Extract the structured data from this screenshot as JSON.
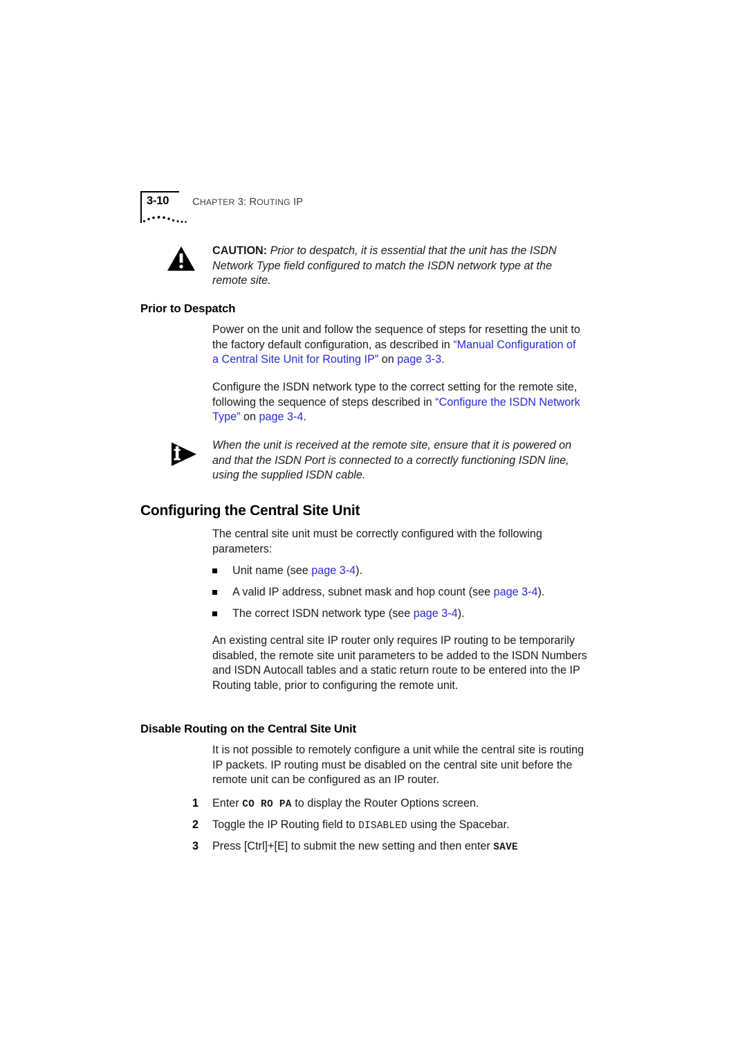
{
  "header": {
    "folio": "3-10",
    "chapter_prefix": "C",
    "chapter_rest": "HAPTER",
    "chapter_text": "CHAPTER 3: ROUTING IP",
    "chapter_number": "3:",
    "chapter_title_prefix": "R",
    "chapter_title_rest": "OUTING",
    "chapter_title_last": "IP"
  },
  "caution": {
    "icon": "warning-triangle-icon",
    "label": "CAUTION:",
    "text": " Prior to despatch, it is essential that the unit has the ISDN Network Type field configured to match the ISDN network type at the remote site."
  },
  "prior_to_despatch": {
    "heading": "Prior to Despatch",
    "para1_before": "Power on the unit and follow the sequence of steps for resetting the unit to the factory default configuration, as described in ",
    "para1_link1": "“Manual Configuration of a Central Site Unit for Routing IP”",
    "para1_mid": " on ",
    "para1_link2": "page 3-3",
    "para1_after": ".",
    "para2_before": "Configure the ISDN network type to the correct setting for the remote site, following the sequence of steps described in ",
    "para2_link1": "“Configure the ISDN Network Type”",
    "para2_mid": " on ",
    "para2_link2": "page 3-4",
    "para2_after": "."
  },
  "note": {
    "icon": "info-triangle-icon",
    "text": "When the unit is received at the remote site, ensure that it is powered on and that the ISDN Port is connected to a correctly functioning ISDN line, using the supplied ISDN cable."
  },
  "configuring_section": {
    "heading": "Configuring the Central Site Unit",
    "intro": "The central site unit must be correctly configured with the following parameters:",
    "bullets": [
      {
        "before": "Unit name (see ",
        "link": "page 3-4",
        "after": ")."
      },
      {
        "before": "A valid IP address, subnet mask and hop count (see ",
        "link": "page 3-4",
        "after": ")."
      },
      {
        "before": "The correct ISDN network type (see ",
        "link": "page 3-4",
        "after": ")."
      }
    ],
    "para": "An existing central site IP router only requires IP routing to be temporarily disabled, the remote site unit parameters to be added to the ISDN Numbers and ISDN Autocall tables and a static return route to be entered into the IP Routing table, prior to configuring the remote unit."
  },
  "disable_routing": {
    "heading": "Disable Routing on the Central Site Unit",
    "para": "It is not possible to remotely configure a unit while the central site is routing IP packets. IP routing must be disabled on the central site unit before the remote unit can be configured as an IP router.",
    "steps": [
      {
        "number": "1",
        "before": "Enter ",
        "code": "CO RO PA",
        "code_style": "bold",
        "after": " to display the Router Options screen."
      },
      {
        "number": "2",
        "before": "Toggle the IP Routing field to ",
        "code": "DISABLED",
        "code_style": "regular",
        "after": " using the Spacebar."
      },
      {
        "number": "3",
        "before": "Press [Ctrl]+[E] to submit the new setting and then enter ",
        "code": "SAVE",
        "code_style": "bold",
        "after": ""
      }
    ]
  },
  "colors": {
    "link": "#2b2bd4",
    "text": "#1a1a1a",
    "rule": "#000000"
  }
}
